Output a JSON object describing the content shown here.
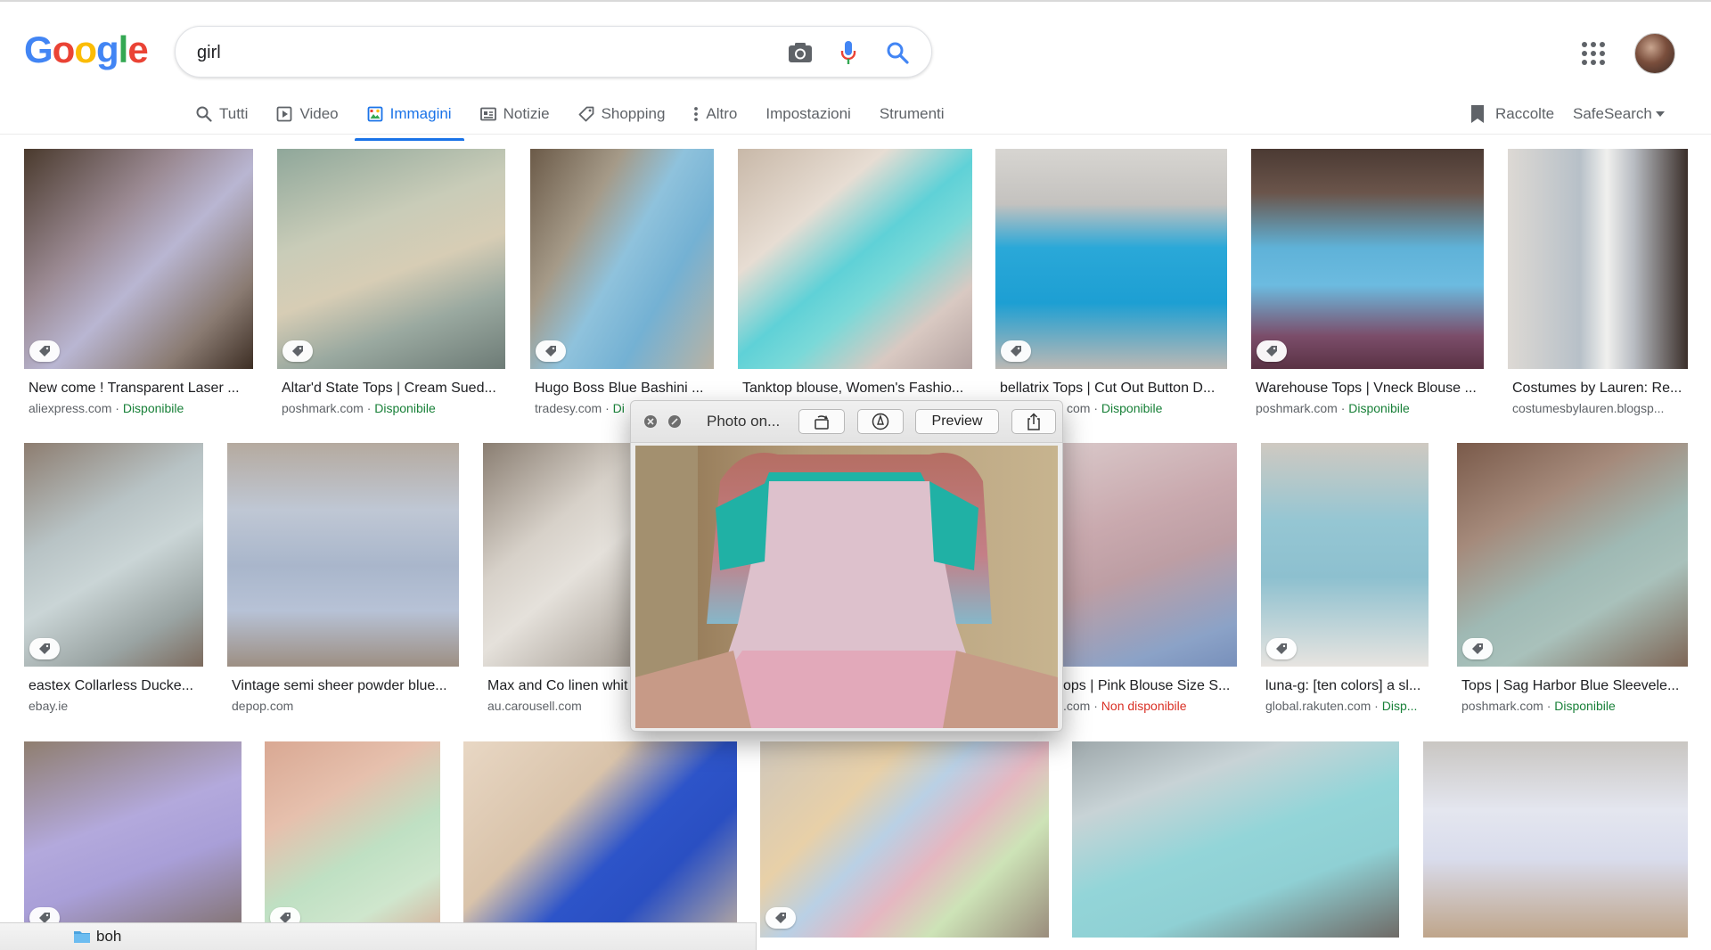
{
  "logo": {
    "letters": [
      "G",
      "o",
      "o",
      "g",
      "l",
      "e"
    ],
    "colors": [
      "#4285F4",
      "#EA4335",
      "#FBBC05",
      "#4285F4",
      "#34A853",
      "#EA4335"
    ]
  },
  "search": {
    "value": "girl"
  },
  "tabs": [
    {
      "label": "Tutti",
      "icon": "search-icon",
      "active": false
    },
    {
      "label": "Video",
      "icon": "video-icon",
      "active": false
    },
    {
      "label": "Immagini",
      "icon": "image-icon",
      "active": true
    },
    {
      "label": "Notizie",
      "icon": "news-icon",
      "active": false
    },
    {
      "label": "Shopping",
      "icon": "tag-icon",
      "active": false
    },
    {
      "label": "Altro",
      "icon": "more-vert-icon",
      "active": false
    }
  ],
  "tools": {
    "settings": "Impostazioni",
    "tools": "Strumenti",
    "collections": "Raccolte",
    "safesearch": "SafeSearch"
  },
  "results": [
    {
      "title": "New come ! Transparent Laser ...",
      "source": "aliexpress.com",
      "status": "Disponibile",
      "status_type": "ok"
    },
    {
      "title": "Altar'd State Tops | Cream Sued...",
      "source": "poshmark.com",
      "status": "Disponibile",
      "status_type": "ok"
    },
    {
      "title": "Hugo Boss Blue Bashini ...",
      "source": "tradesy.com",
      "status": "Di",
      "status_type": "ok"
    },
    {
      "title": "Tanktop blouse, Women's Fashio...",
      "source": "",
      "status": "",
      "status_type": "ok"
    },
    {
      "title": "bellatrix Tops | Cut Out Button D...",
      "source": "com",
      "status": "Disponibile",
      "status_type": "ok"
    },
    {
      "title": "Warehouse Tops | Vneck Blouse ...",
      "source": "poshmark.com",
      "status": "Disponibile",
      "status_type": "ok"
    },
    {
      "title": "Costumes by Lauren: Re...",
      "source": "costumesbylauren.blogsp...",
      "status": "",
      "status_type": "ok"
    },
    {
      "title": "eastex Collarless Ducke...",
      "source": "ebay.ie",
      "status": "",
      "status_type": "ok"
    },
    {
      "title": "Vintage semi sheer powder blue...",
      "source": "depop.com",
      "status": "",
      "status_type": "ok"
    },
    {
      "title": "Max and Co linen whit",
      "source": "au.carousell.com",
      "status": "",
      "status_type": "ok"
    },
    {
      "title": "ops | Pink Blouse Size S...",
      "source": ".com",
      "status": "Non disponibile",
      "status_type": "no"
    },
    {
      "title": "luna-g: [ten colors] a sl...",
      "source": "global.rakuten.com",
      "status": "Disp...",
      "status_type": "ok"
    },
    {
      "title": "Tops | Sag Harbor Blue Sleevele...",
      "source": "poshmark.com",
      "status": "Disponibile",
      "status_type": "ok"
    }
  ],
  "quicklook": {
    "title": "Photo on...",
    "preview_label": "Preview"
  },
  "finder": {
    "label": "boh"
  }
}
